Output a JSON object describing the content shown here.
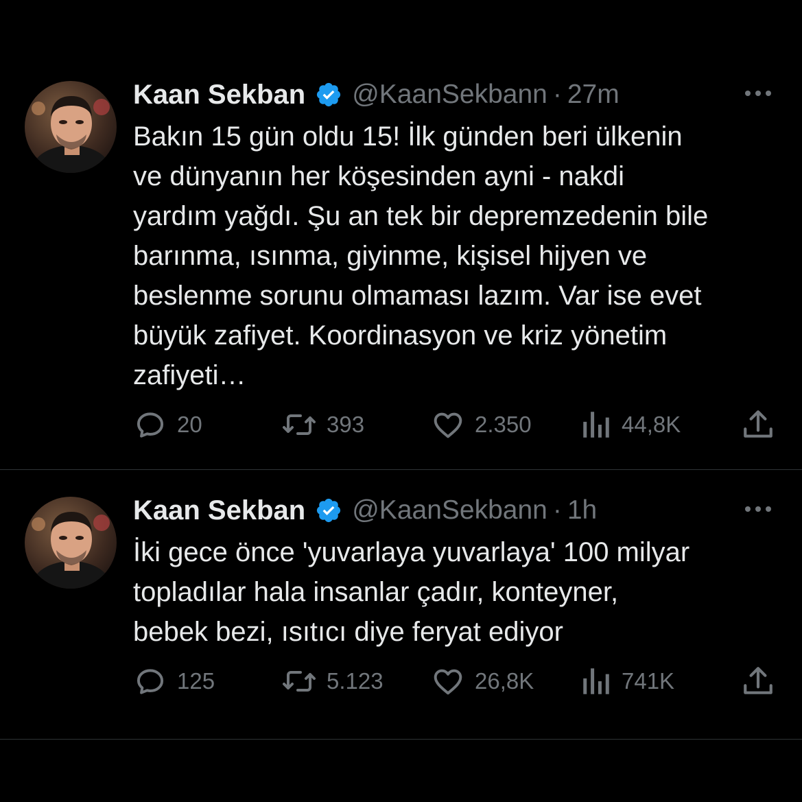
{
  "tweets": [
    {
      "author": {
        "name": "Kaan Sekban",
        "handle": "@KaanSekbann",
        "verified": true
      },
      "separator": "·",
      "time": "27m",
      "text": "Bakın 15 gün oldu 15! İlk günden beri ülkenin\nve dünyanın her köşesinden ayni - nakdi\nyardım yağdı. Şu an tek bir depremzedenin bile\nbarınma, ısınma, giyinme, kişisel hijyen ve\nbeslenme sorunu olmaması lazım. Var ise evet\nbüyük zafiyet. Koordinasyon ve kriz yönetim\nzafiyeti…",
      "stats": {
        "replies": "20",
        "retweets": "393",
        "likes": "2.350",
        "views": "44,8K"
      }
    },
    {
      "author": {
        "name": "Kaan Sekban",
        "handle": "@KaanSekbann",
        "verified": true
      },
      "separator": "·",
      "time": "1h",
      "text": "İki gece önce 'yuvarlaya yuvarlaya' 100 milyar\ntopladılar hala insanlar çadır, konteyner,\nbebek bezi, ısıtıcı diye feryat ediyor",
      "stats": {
        "replies": "125",
        "retweets": "5.123",
        "likes": "26,8K",
        "views": "741K"
      }
    }
  ],
  "icons": {
    "verified": "verified-badge-icon",
    "more": "more-dots-icon",
    "reply": "reply-bubble-icon",
    "retweet": "retweet-arrows-icon",
    "like": "heart-icon",
    "views": "views-bars-icon",
    "share": "share-upload-icon"
  },
  "colors": {
    "background": "#000000",
    "text_primary": "#e7e9ea",
    "text_secondary": "#71767b",
    "verified": "#1d9bf0",
    "divider": "#2f3336"
  }
}
